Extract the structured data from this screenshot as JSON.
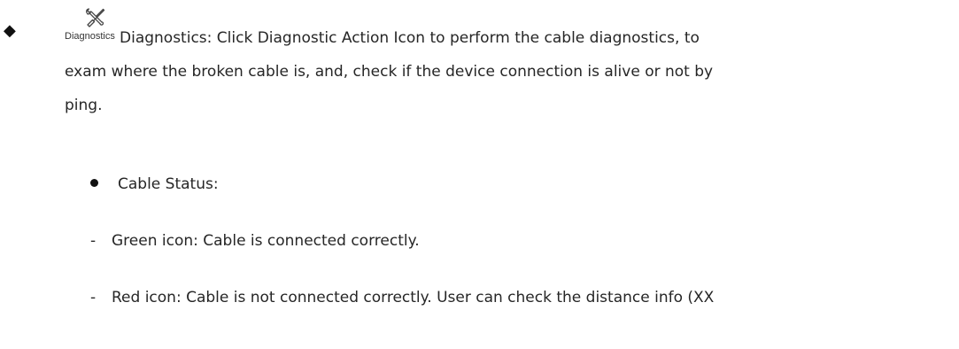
{
  "section": {
    "bullet_glyph": "◆",
    "icon": {
      "name": "wrench-screwdriver-icon",
      "label": "Diagnostics"
    },
    "paragraph": {
      "line1": "Diagnostics: Click Diagnostic Action Icon to perform the cable diagnostics, to",
      "line2": "exam where the broken cable is, and, check if the device connection is alive or not by",
      "line3": "ping."
    }
  },
  "cable_status": {
    "heading": "Cable Status:",
    "items": [
      {
        "marker": "-",
        "text": "Green icon: Cable is connected correctly."
      },
      {
        "marker": "-",
        "text": "Red icon: Cable is not connected correctly. User can check the distance info (XX"
      }
    ]
  }
}
